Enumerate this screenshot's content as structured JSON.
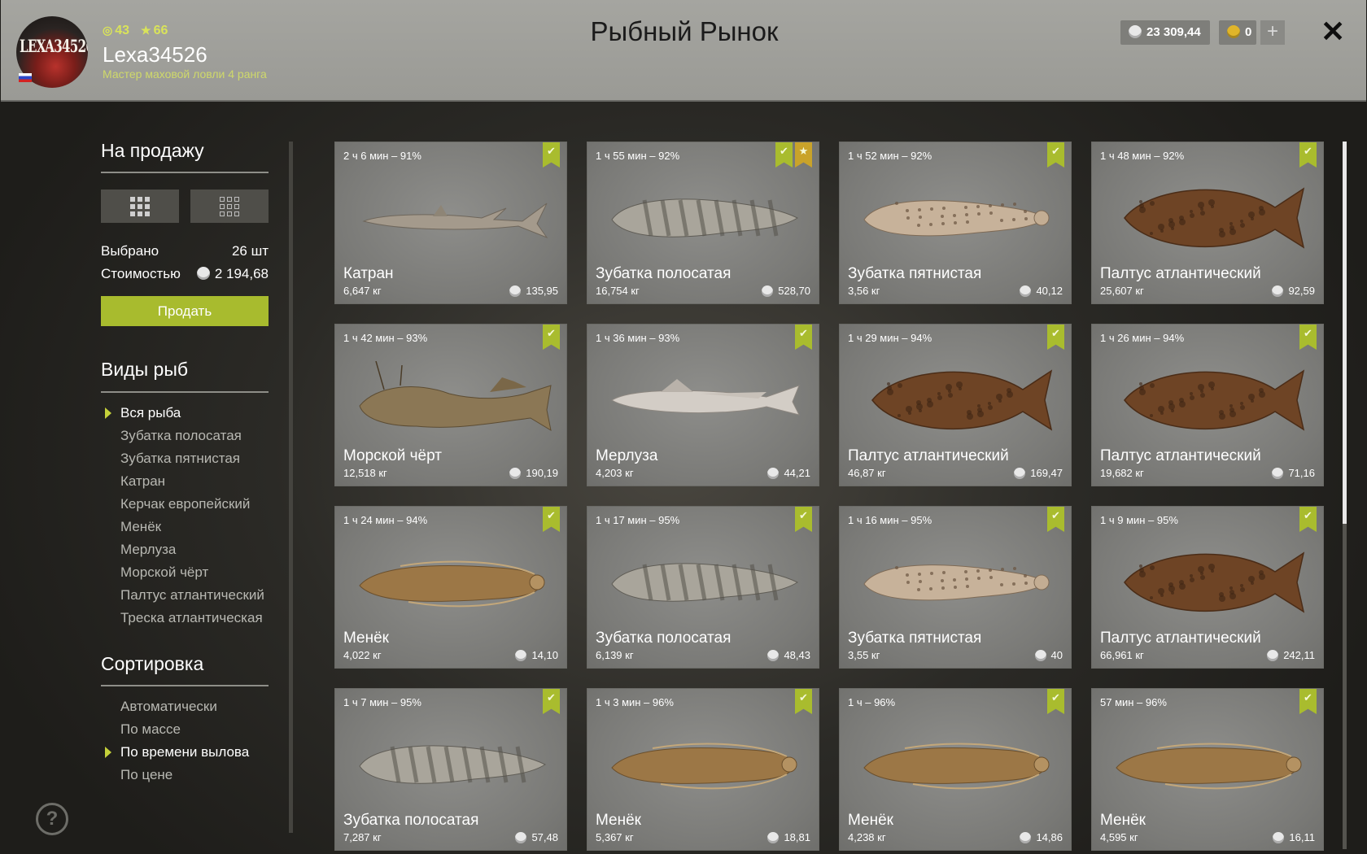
{
  "header": {
    "avatar_text": "LEXA34526",
    "stat1": "43",
    "stat2": "66",
    "username": "Lexa34526",
    "rank": "Мастер маховой ловли 4 ранга",
    "title": "Рыбный Рынок",
    "silver": "23 309,44",
    "gold": "0",
    "plus": "+",
    "close": "✕"
  },
  "sidebar": {
    "for_sale_title": "На продажу",
    "selected_label": "Выбрано",
    "selected_value": "26 шт",
    "cost_label": "Стоимостью",
    "cost_value": "2 194,68",
    "sell_button": "Продать",
    "species_title": "Виды рыб",
    "species": [
      "Вся рыба",
      "Зубатка полосатая",
      "Зубатка пятнистая",
      "Катран",
      "Керчак европейский",
      "Менёк",
      "Мерлуза",
      "Морской чёрт",
      "Палтус атлантический",
      "Треска атлантическая"
    ],
    "sort_title": "Сортировка",
    "sort": [
      "Автоматически",
      "По массе",
      "По времени вылова",
      "По цене"
    ],
    "help": "?"
  },
  "colors": {
    "accent": "#a8bb2e",
    "title_text": "#1b1b1b",
    "rank_text": "#cfd96a"
  },
  "cards": [
    {
      "time": "2 ч 6 мин – 91%",
      "name": "Катран",
      "weight": "6,647 кг",
      "price": "135,95",
      "fish": "shark",
      "star": false
    },
    {
      "time": "1 ч 55 мин – 92%",
      "name": "Зубатка полосатая",
      "weight": "16,754 кг",
      "price": "528,70",
      "fish": "wolffish-striped",
      "star": true
    },
    {
      "time": "1 ч 52 мин – 92%",
      "name": "Зубатка пятнистая",
      "weight": "3,56 кг",
      "price": "40,12",
      "fish": "wolffish-spotted",
      "star": false
    },
    {
      "time": "1 ч 48 мин – 92%",
      "name": "Палтус атлантический",
      "weight": "25,607 кг",
      "price": "92,59",
      "fish": "halibut",
      "star": false
    },
    {
      "time": "1 ч 42 мин – 93%",
      "name": "Морской чёрт",
      "weight": "12,518 кг",
      "price": "190,19",
      "fish": "monkfish",
      "star": false
    },
    {
      "time": "1 ч 36 мин – 93%",
      "name": "Мерлуза",
      "weight": "4,203 кг",
      "price": "44,21",
      "fish": "hake",
      "star": false
    },
    {
      "time": "1 ч 29 мин – 94%",
      "name": "Палтус атлантический",
      "weight": "46,87 кг",
      "price": "169,47",
      "fish": "halibut",
      "star": false
    },
    {
      "time": "1 ч 26 мин – 94%",
      "name": "Палтус атлантический",
      "weight": "19,682 кг",
      "price": "71,16",
      "fish": "halibut",
      "star": false
    },
    {
      "time": "1 ч 24 мин – 94%",
      "name": "Менёк",
      "weight": "4,022 кг",
      "price": "14,10",
      "fish": "tusk",
      "star": false
    },
    {
      "time": "1 ч 17 мин – 95%",
      "name": "Зубатка полосатая",
      "weight": "6,139 кг",
      "price": "48,43",
      "fish": "wolffish-striped",
      "star": false
    },
    {
      "time": "1 ч 16 мин – 95%",
      "name": "Зубатка пятнистая",
      "weight": "3,55 кг",
      "price": "40",
      "fish": "wolffish-spotted",
      "star": false
    },
    {
      "time": "1 ч 9 мин – 95%",
      "name": "Палтус атлантический",
      "weight": "66,961 кг",
      "price": "242,11",
      "fish": "halibut",
      "star": false
    },
    {
      "time": "1 ч 7 мин – 95%",
      "name": "Зубатка полосатая",
      "weight": "7,287 кг",
      "price": "57,48",
      "fish": "wolffish-striped",
      "star": false
    },
    {
      "time": "1 ч 3 мин – 96%",
      "name": "Менёк",
      "weight": "5,367 кг",
      "price": "18,81",
      "fish": "tusk",
      "star": false
    },
    {
      "time": "1 ч – 96%",
      "name": "Менёк",
      "weight": "4,238 кг",
      "price": "14,86",
      "fish": "tusk",
      "star": false
    },
    {
      "time": "57 мин – 96%",
      "name": "Менёк",
      "weight": "4,595 кг",
      "price": "16,11",
      "fish": "tusk",
      "star": false
    }
  ]
}
